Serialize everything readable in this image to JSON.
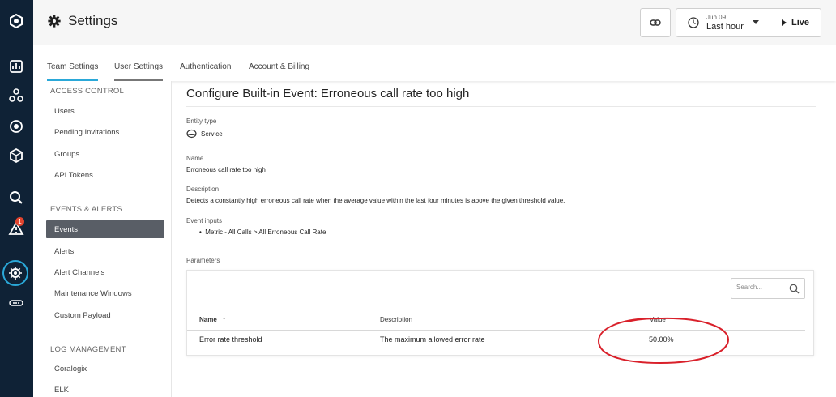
{
  "header": {
    "title": "Settings",
    "time_date": "Jun 09",
    "time_range": "Last hour",
    "live_label": "Live"
  },
  "rail": {
    "alerts_badge": "1"
  },
  "tabs": [
    {
      "label": "Team Settings"
    },
    {
      "label": "User Settings"
    },
    {
      "label": "Authentication"
    },
    {
      "label": "Account & Billing"
    }
  ],
  "sidebar": {
    "sections": [
      {
        "title": "ACCESS CONTROL",
        "items": [
          "Users",
          "Pending Invitations",
          "Groups",
          "API Tokens"
        ]
      },
      {
        "title": "EVENTS & ALERTS",
        "items": [
          "Events",
          "Alerts",
          "Alert Channels",
          "Maintenance Windows",
          "Custom Payload"
        ]
      },
      {
        "title": "LOG MANAGEMENT",
        "items": [
          "Coralogix",
          "ELK"
        ]
      }
    ],
    "active_item": "Events"
  },
  "main": {
    "title": "Configure Built-in Event: Erroneous call rate too high",
    "entity_type_label": "Entity type",
    "entity_type_value": "Service",
    "name_label": "Name",
    "name_value": "Erroneous call rate too high",
    "description_label": "Description",
    "description_value": "Detects a constantly high erroneous call rate when the average value within the last four minutes is above the given threshold value.",
    "inputs_label": "Event inputs",
    "inputs": [
      "Metric - All Calls > All Erroneous Call Rate"
    ],
    "parameters_label": "Parameters"
  },
  "parameters_table": {
    "search_placeholder": "Search...",
    "columns": [
      "Name",
      "Description",
      "Value"
    ],
    "sort_arrow": "↑",
    "rows": [
      {
        "name": "Error rate threshold",
        "description": "The maximum allowed error rate",
        "value": "50.00%"
      }
    ]
  },
  "colors": {
    "rail_bg": "#0f2236",
    "accent": "#2aa8d8",
    "active_item_bg": "#595e66",
    "annotation_red": "#d9202a"
  }
}
